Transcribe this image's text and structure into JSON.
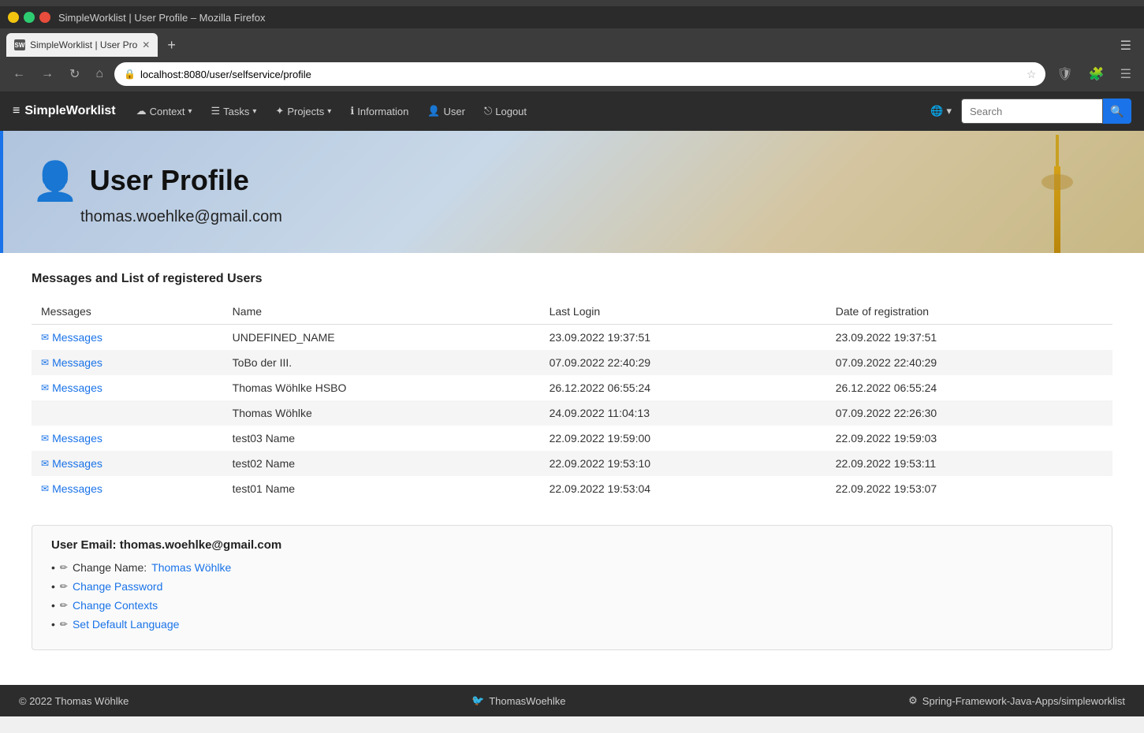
{
  "os_bar": {},
  "title_bar": {
    "title": "SimpleWorklist | User Profile – Mozilla Firefox"
  },
  "tab_bar": {
    "tab_title": "SimpleWorklist | User Pro",
    "tab_favicon": "SW",
    "new_tab_label": "+",
    "menu_label": "☰"
  },
  "address_bar": {
    "url": "localhost:8080/user/selfservice/profile",
    "back_btn": "←",
    "forward_btn": "→",
    "refresh_btn": "↻",
    "home_btn": "⌂"
  },
  "navbar": {
    "brand": "SimpleWorklist",
    "brand_icon": "≡",
    "items": [
      {
        "label": "Context",
        "icon": "☁",
        "has_caret": true
      },
      {
        "label": "Tasks",
        "icon": "☰",
        "has_caret": true
      },
      {
        "label": "Projects",
        "icon": "✦",
        "has_caret": true
      },
      {
        "label": "Information",
        "icon": "ℹ",
        "has_caret": false
      },
      {
        "label": "User",
        "icon": "👤",
        "has_caret": false
      },
      {
        "label": "Logout",
        "icon": "⎋",
        "has_caret": false
      }
    ],
    "globe_label": "🌐",
    "globe_caret": "▾",
    "search_placeholder": "Search",
    "search_btn_icon": "🔍"
  },
  "hero": {
    "icon": "👤",
    "title": "User Profile",
    "subtitle": "thomas.woehlke@gmail.com"
  },
  "main": {
    "section_title": "Messages and List of registered Users",
    "table": {
      "headers": [
        "Messages",
        "Name",
        "Last Login",
        "Date of registration"
      ],
      "rows": [
        {
          "has_message": true,
          "msg_label": "Messages",
          "name": "UNDEFINED_NAME",
          "last_login": "23.09.2022 19:37:51",
          "date_reg": "23.09.2022 19:37:51"
        },
        {
          "has_message": true,
          "msg_label": "Messages",
          "name": "ToBo der III.",
          "last_login": "07.09.2022 22:40:29",
          "date_reg": "07.09.2022 22:40:29"
        },
        {
          "has_message": true,
          "msg_label": "Messages",
          "name": "Thomas Wöhlke HSBO",
          "last_login": "26.12.2022 06:55:24",
          "date_reg": "26.12.2022 06:55:24"
        },
        {
          "has_message": false,
          "msg_label": "",
          "name": "Thomas Wöhlke",
          "last_login": "24.09.2022 11:04:13",
          "date_reg": "07.09.2022 22:26:30"
        },
        {
          "has_message": true,
          "msg_label": "Messages",
          "name": "test03 Name",
          "last_login": "22.09.2022 19:59:00",
          "date_reg": "22.09.2022 19:59:03"
        },
        {
          "has_message": true,
          "msg_label": "Messages",
          "name": "test02 Name",
          "last_login": "22.09.2022 19:53:10",
          "date_reg": "22.09.2022 19:53:11"
        },
        {
          "has_message": true,
          "msg_label": "Messages",
          "name": "test01 Name",
          "last_login": "22.09.2022 19:53:04",
          "date_reg": "22.09.2022 19:53:07"
        }
      ]
    },
    "user_info": {
      "email_prefix": "User Email:",
      "email": "thomas.woehlke@gmail.com",
      "actions": [
        {
          "prefix": "Change Name:",
          "link_text": "Thomas Wöhlke",
          "is_link": true
        },
        {
          "prefix": "",
          "link_text": "Change Password",
          "is_link": true
        },
        {
          "prefix": "",
          "link_text": "Change Contexts",
          "is_link": true
        },
        {
          "prefix": "",
          "link_text": "Set Default Language",
          "is_link": true
        }
      ]
    }
  },
  "footer": {
    "copyright": "© 2022 Thomas Wöhlke",
    "twitter_label": "ThomasWoehlke",
    "github_label": "Spring-Framework-Java-Apps/simpleworklist"
  }
}
